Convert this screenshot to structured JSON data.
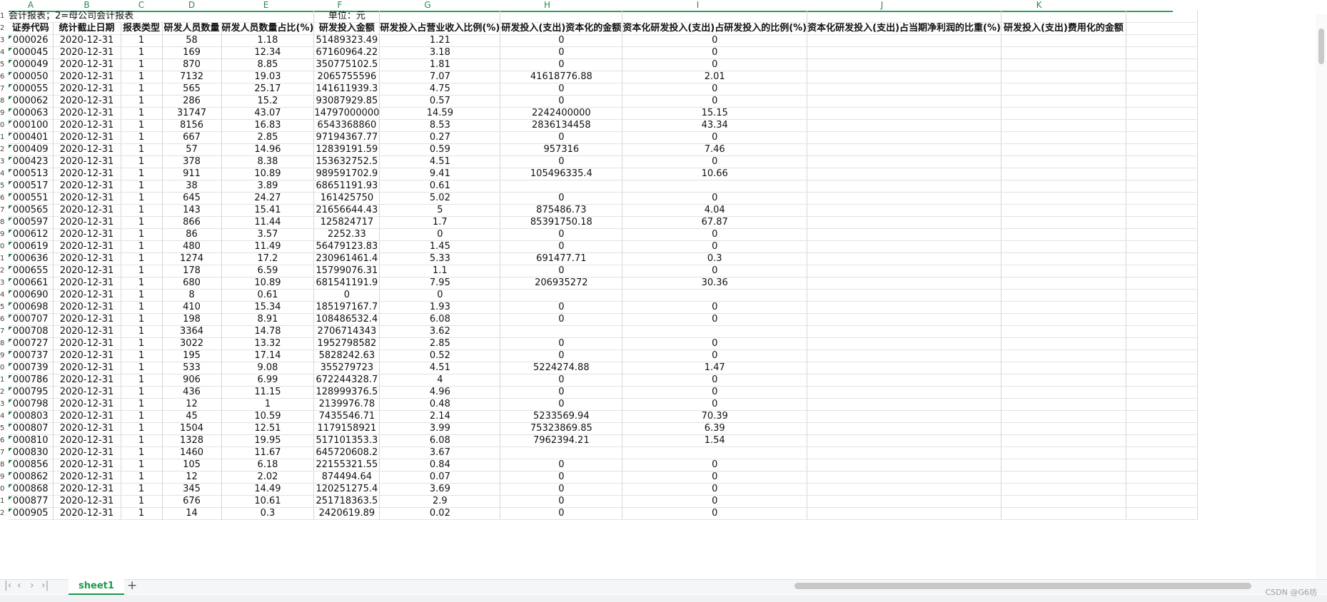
{
  "columns": [
    "A",
    "B",
    "C",
    "D",
    "E",
    "F",
    "G",
    "H",
    "I",
    "J",
    "K"
  ],
  "note": {
    "left": "会计报表；2=母公司会计报表",
    "unit": "单位：元"
  },
  "headers": [
    "证券代码",
    "统计截止日期",
    "报表类型",
    "研发人员数量",
    "研发人员数量占比(%)",
    "研发投入金额",
    "研发投入占营业收入比例(%)",
    "研发投入(支出)资本化的金额",
    "资本化研发投入(支出)占研发投入的比例(%)",
    "资本化研发投入(支出)占当期净利润的比重(%)",
    "研发投入(支出)费用化的金额"
  ],
  "rows": [
    [
      "000026",
      "2020-12-31",
      "1",
      "58",
      "1.18",
      "51489323.49",
      "1.21",
      "0",
      "0",
      "",
      ""
    ],
    [
      "000045",
      "2020-12-31",
      "1",
      "169",
      "12.34",
      "67160964.22",
      "3.18",
      "0",
      "0",
      "",
      ""
    ],
    [
      "000049",
      "2020-12-31",
      "1",
      "870",
      "8.85",
      "350775102.5",
      "1.81",
      "0",
      "0",
      "",
      ""
    ],
    [
      "000050",
      "2020-12-31",
      "1",
      "7132",
      "19.03",
      "2065755596",
      "7.07",
      "41618776.88",
      "2.01",
      "",
      ""
    ],
    [
      "000055",
      "2020-12-31",
      "1",
      "565",
      "25.17",
      "141611939.3",
      "4.75",
      "0",
      "0",
      "",
      ""
    ],
    [
      "000062",
      "2020-12-31",
      "1",
      "286",
      "15.2",
      "93087929.85",
      "0.57",
      "0",
      "0",
      "",
      ""
    ],
    [
      "000063",
      "2020-12-31",
      "1",
      "31747",
      "43.07",
      "14797000000",
      "14.59",
      "2242400000",
      "15.15",
      "",
      ""
    ],
    [
      "000100",
      "2020-12-31",
      "1",
      "8156",
      "16.83",
      "6543368860",
      "8.53",
      "2836134458",
      "43.34",
      "",
      ""
    ],
    [
      "000401",
      "2020-12-31",
      "1",
      "667",
      "2.85",
      "97194367.77",
      "0.27",
      "0",
      "0",
      "",
      ""
    ],
    [
      "000409",
      "2020-12-31",
      "1",
      "57",
      "14.96",
      "12839191.59",
      "0.59",
      "957316",
      "7.46",
      "",
      ""
    ],
    [
      "000423",
      "2020-12-31",
      "1",
      "378",
      "8.38",
      "153632752.5",
      "4.51",
      "0",
      "0",
      "",
      ""
    ],
    [
      "000513",
      "2020-12-31",
      "1",
      "911",
      "10.89",
      "989591702.9",
      "9.41",
      "105496335.4",
      "10.66",
      "",
      ""
    ],
    [
      "000517",
      "2020-12-31",
      "1",
      "38",
      "3.89",
      "68651191.93",
      "0.61",
      "",
      "",
      "",
      ""
    ],
    [
      "000551",
      "2020-12-31",
      "1",
      "645",
      "24.27",
      "161425750",
      "5.02",
      "0",
      "0",
      "",
      ""
    ],
    [
      "000565",
      "2020-12-31",
      "1",
      "143",
      "15.41",
      "21656644.43",
      "5",
      "875486.73",
      "4.04",
      "",
      ""
    ],
    [
      "000597",
      "2020-12-31",
      "1",
      "866",
      "11.44",
      "125824717",
      "1.7",
      "85391750.18",
      "67.87",
      "",
      ""
    ],
    [
      "000612",
      "2020-12-31",
      "1",
      "86",
      "3.57",
      "2252.33",
      "0",
      "0",
      "0",
      "",
      ""
    ],
    [
      "000619",
      "2020-12-31",
      "1",
      "480",
      "11.49",
      "56479123.83",
      "1.45",
      "0",
      "0",
      "",
      ""
    ],
    [
      "000636",
      "2020-12-31",
      "1",
      "1274",
      "17.2",
      "230961461.4",
      "5.33",
      "691477.71",
      "0.3",
      "",
      ""
    ],
    [
      "000655",
      "2020-12-31",
      "1",
      "178",
      "6.59",
      "15799076.31",
      "1.1",
      "0",
      "0",
      "",
      ""
    ],
    [
      "000661",
      "2020-12-31",
      "1",
      "680",
      "10.89",
      "681541191.9",
      "7.95",
      "206935272",
      "30.36",
      "",
      ""
    ],
    [
      "000690",
      "2020-12-31",
      "1",
      "8",
      "0.61",
      "0",
      "0",
      "",
      "",
      "",
      ""
    ],
    [
      "000698",
      "2020-12-31",
      "1",
      "410",
      "15.34",
      "185197167.7",
      "1.93",
      "0",
      "0",
      "",
      ""
    ],
    [
      "000707",
      "2020-12-31",
      "1",
      "198",
      "8.91",
      "108486532.4",
      "6.08",
      "0",
      "0",
      "",
      ""
    ],
    [
      "000708",
      "2020-12-31",
      "1",
      "3364",
      "14.78",
      "2706714343",
      "3.62",
      "",
      "",
      "",
      ""
    ],
    [
      "000727",
      "2020-12-31",
      "1",
      "3022",
      "13.32",
      "1952798582",
      "2.85",
      "0",
      "0",
      "",
      ""
    ],
    [
      "000737",
      "2020-12-31",
      "1",
      "195",
      "17.14",
      "5828242.63",
      "0.52",
      "0",
      "0",
      "",
      ""
    ],
    [
      "000739",
      "2020-12-31",
      "1",
      "533",
      "9.08",
      "355279723",
      "4.51",
      "5224274.88",
      "1.47",
      "",
      ""
    ],
    [
      "000786",
      "2020-12-31",
      "1",
      "906",
      "6.99",
      "672244328.7",
      "4",
      "0",
      "0",
      "",
      ""
    ],
    [
      "000795",
      "2020-12-31",
      "1",
      "436",
      "11.15",
      "128999376.5",
      "4.96",
      "0",
      "0",
      "",
      ""
    ],
    [
      "000798",
      "2020-12-31",
      "1",
      "12",
      "1",
      "2139976.78",
      "0.48",
      "0",
      "0",
      "",
      ""
    ],
    [
      "000803",
      "2020-12-31",
      "1",
      "45",
      "10.59",
      "7435546.71",
      "2.14",
      "5233569.94",
      "70.39",
      "",
      ""
    ],
    [
      "000807",
      "2020-12-31",
      "1",
      "1504",
      "12.51",
      "1179158921",
      "3.99",
      "75323869.85",
      "6.39",
      "",
      ""
    ],
    [
      "000810",
      "2020-12-31",
      "1",
      "1328",
      "19.95",
      "517101353.3",
      "6.08",
      "7962394.21",
      "1.54",
      "",
      ""
    ],
    [
      "000830",
      "2020-12-31",
      "1",
      "1460",
      "11.67",
      "645720608.2",
      "3.67",
      "",
      "",
      "",
      ""
    ],
    [
      "000856",
      "2020-12-31",
      "1",
      "105",
      "6.18",
      "22155321.55",
      "0.84",
      "0",
      "0",
      "",
      ""
    ],
    [
      "000862",
      "2020-12-31",
      "1",
      "12",
      "2.02",
      "874494.64",
      "0.07",
      "0",
      "0",
      "",
      ""
    ],
    [
      "000868",
      "2020-12-31",
      "1",
      "345",
      "14.49",
      "120251275.4",
      "3.69",
      "0",
      "0",
      "",
      ""
    ],
    [
      "000877",
      "2020-12-31",
      "1",
      "676",
      "10.61",
      "251718363.5",
      "2.9",
      "0",
      "0",
      "",
      ""
    ],
    [
      "000905",
      "2020-12-31",
      "1",
      "14",
      "0.3",
      "2420619.89",
      "0.02",
      "0",
      "0",
      "",
      ""
    ]
  ],
  "sheet_tab": "sheet1",
  "add_tab": "+",
  "watermark": "CSDN @G6坊",
  "colors": {
    "accent": "#1c9a4c",
    "header_line": "#2f9e5f"
  }
}
